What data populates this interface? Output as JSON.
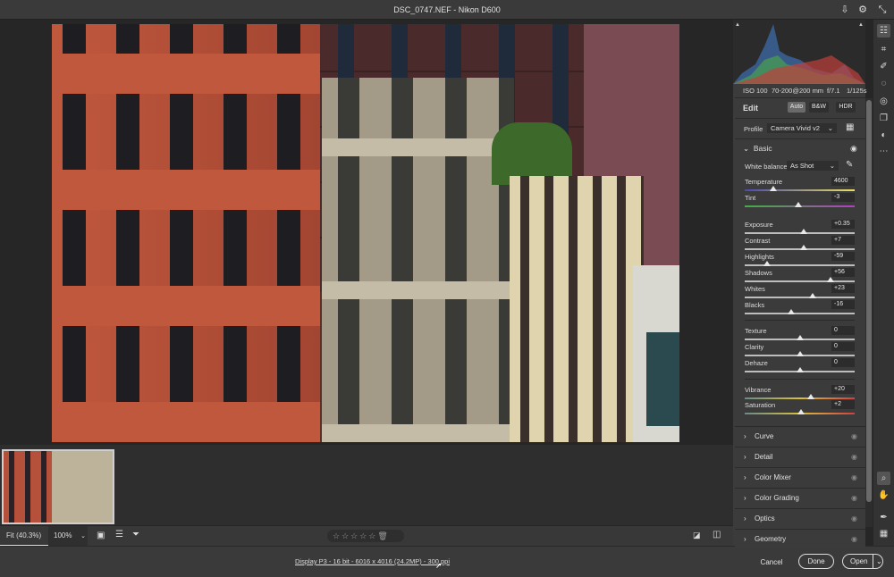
{
  "window": {
    "title": "DSC_0747.NEF  -  Nikon D600"
  },
  "topbar_icons": [
    "export-icon",
    "gear-icon",
    "collapse-icon"
  ],
  "info": {
    "iso": "ISO 100",
    "lens": "70-200@200 mm",
    "aperture": "f/7.1",
    "shutter": "1/125s"
  },
  "edit": {
    "title": "Edit",
    "auto": "Auto",
    "bw": "B&W",
    "hdr": "HDR",
    "profile_label": "Profile",
    "profile_value": "Camera Vivid v2"
  },
  "basic": {
    "title": "Basic",
    "wb_label": "White balance",
    "wb_value": "As Shot",
    "sliders": [
      {
        "label": "Temperature",
        "value": "4600",
        "position": 0.26,
        "track": "temp"
      },
      {
        "label": "Tint",
        "value": "-3",
        "position": 0.49,
        "track": "tint"
      },
      {
        "label": "Exposure",
        "value": "+0.35",
        "position": 0.535
      },
      {
        "label": "Contrast",
        "value": "+7",
        "position": 0.535
      },
      {
        "label": "Highlights",
        "value": "-59",
        "position": 0.205
      },
      {
        "label": "Shadows",
        "value": "+56",
        "position": 0.78
      },
      {
        "label": "Whites",
        "value": "+23",
        "position": 0.615
      },
      {
        "label": "Blacks",
        "value": "-16",
        "position": 0.42
      },
      {
        "label": "Texture",
        "value": "0",
        "position": 0.5
      },
      {
        "label": "Clarity",
        "value": "0",
        "position": 0.5
      },
      {
        "label": "Dehaze",
        "value": "0",
        "position": 0.5
      },
      {
        "label": "Vibrance",
        "value": "+20",
        "position": 0.6,
        "track": "sat"
      },
      {
        "label": "Saturation",
        "value": "+2",
        "position": 0.51,
        "track": "sat"
      }
    ]
  },
  "sections": [
    "Curve",
    "Detail",
    "Color Mixer",
    "Color Grading",
    "Optics",
    "Geometry"
  ],
  "toolbar": {
    "fit": "Fit (40.3%)",
    "zoom": "100%",
    "rating_stars": 0
  },
  "footer": {
    "info": "Display P3 - 16 bit - 6016 x 4016 (24.2MP) - 300 ppi",
    "cancel": "Cancel",
    "done": "Done",
    "open": "Open"
  }
}
